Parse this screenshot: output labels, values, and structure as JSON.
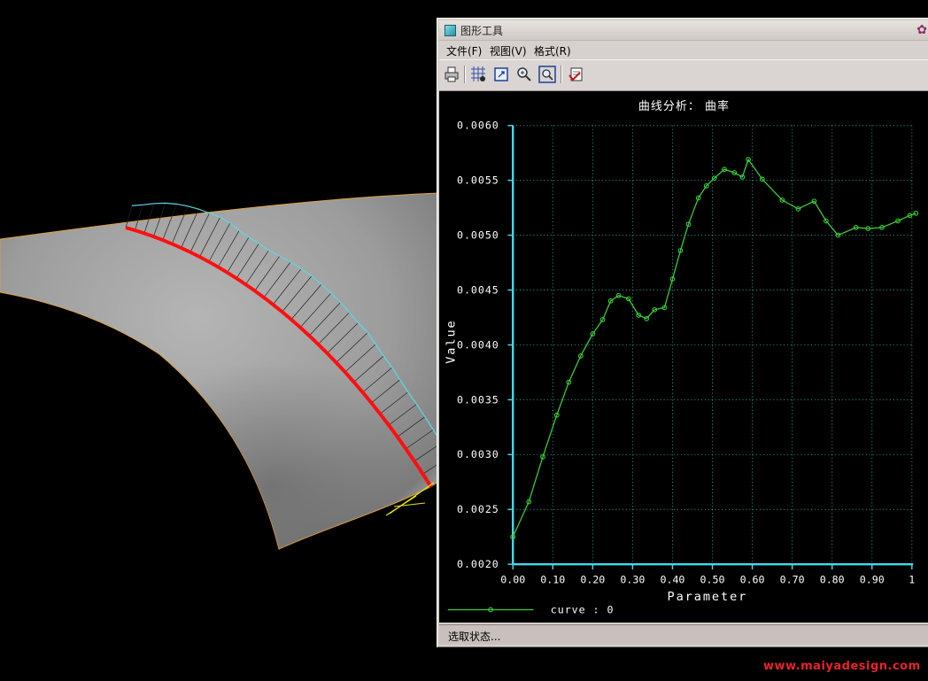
{
  "window": {
    "title": "图形工具"
  },
  "menu": {
    "items": [
      {
        "label": "文件(F)"
      },
      {
        "label": "视图(V)"
      },
      {
        "label": "格式(R)"
      }
    ]
  },
  "toolbar": {
    "buttons": [
      {
        "icon": "printer-icon"
      },
      {
        "icon": "grid-icon"
      },
      {
        "icon": "refit-icon"
      },
      {
        "icon": "zoom-in-icon"
      },
      {
        "icon": "zoom-window-icon"
      },
      {
        "icon": "exit-graph-icon"
      }
    ]
  },
  "statusbar": {
    "text": "选取状态..."
  },
  "watermark": {
    "text": "www.maiyadesign.com"
  },
  "colors": {
    "curve": "#3bd13b",
    "axis": "#45d8e8",
    "grid": "#1fb7a0",
    "highlight_curve": "#ff1010",
    "porcupine": "#5ad8e8",
    "surface": "#a8a8a8"
  },
  "chart_data": {
    "type": "line",
    "title": "曲线分析： 曲率",
    "xlabel": "Parameter",
    "ylabel": "Value",
    "xlim": [
      0,
      1.0
    ],
    "ylim": [
      0.002,
      0.006
    ],
    "grid": true,
    "legend_position": "bottom-left",
    "x_ticks": [
      "0.00",
      "0.10",
      "0.20",
      "0.30",
      "0.40",
      "0.50",
      "0.60",
      "0.70",
      "0.80",
      "0.90",
      "1"
    ],
    "y_ticks": [
      "0.0020",
      "0.0025",
      "0.0030",
      "0.0035",
      "0.0040",
      "0.0045",
      "0.0050",
      "0.0055",
      "0.0060"
    ],
    "series": [
      {
        "name": "curve : 0",
        "x": [
          0.0,
          0.04,
          0.075,
          0.11,
          0.14,
          0.17,
          0.2,
          0.225,
          0.245,
          0.265,
          0.29,
          0.315,
          0.335,
          0.355,
          0.38,
          0.4,
          0.42,
          0.44,
          0.465,
          0.485,
          0.505,
          0.53,
          0.555,
          0.575,
          0.59,
          0.625,
          0.675,
          0.715,
          0.755,
          0.785,
          0.815,
          0.86,
          0.89,
          0.925,
          0.965,
          0.995,
          1.01
        ],
        "y": [
          0.00225,
          0.00257,
          0.00298,
          0.00336,
          0.00366,
          0.0039,
          0.0041,
          0.00423,
          0.0044,
          0.00445,
          0.00442,
          0.00427,
          0.00424,
          0.00432,
          0.00434,
          0.0046,
          0.00486,
          0.0051,
          0.00534,
          0.00545,
          0.00552,
          0.0056,
          0.00557,
          0.00553,
          0.00569,
          0.00551,
          0.00532,
          0.00524,
          0.00531,
          0.00513,
          0.005,
          0.00507,
          0.00506,
          0.00507,
          0.00513,
          0.00518,
          0.0052
        ]
      }
    ]
  }
}
